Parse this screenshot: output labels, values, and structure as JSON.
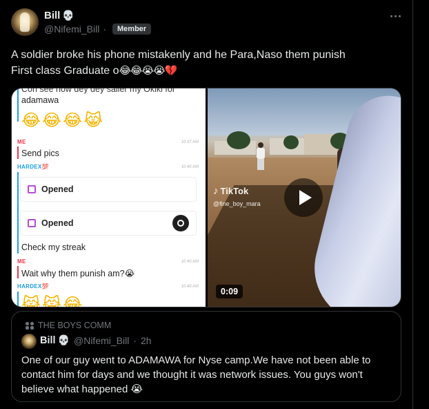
{
  "author": {
    "display_name": "Bill",
    "name_emoji": "💀",
    "handle": "@Nifemi_Bill",
    "separator": "·",
    "badge": "Member"
  },
  "post": {
    "text_line1": "A soldier broke his phone mistakenly and he Para,Naso them punish",
    "text_line2": "First class Graduate o",
    "text_emojis": "😂😂😭😭💔"
  },
  "media": {
    "chat": {
      "partial_top_line": "Con see how dey dey saller my Okiki for",
      "line_adamawa": "adamawa",
      "emoji_row_1": "😂😂😂😹",
      "sender_me": "ME",
      "sender_hardex": "HARDEX💯",
      "msg_send_pics": "Send pics",
      "ts_1": "10:37 AM",
      "ts_2": "10:40 AM",
      "snap_1": "Opened",
      "snap_2": "Opened",
      "msg_check_streak": "Check my streak",
      "ts_3": "10:40 AM",
      "msg_wait_why": "Wait why them punish am?😭",
      "ts_4": "10:40 AM",
      "emoji_row_2": "😹😹😂"
    },
    "video": {
      "watermark": "TikTok",
      "watermark_handle": "@fine_boy_mara",
      "duration": "0:09"
    }
  },
  "quoted": {
    "community": "THE BOYS COMM",
    "display_name": "Bill",
    "name_emoji": "💀",
    "handle": "@Nifemi_Bill",
    "separator": "·",
    "time": "2h",
    "text": "One of our guy went to ADAMAWA for Nyse camp.We have not been able to contact him for days and we thought it was network issues. You guys won't believe what happened",
    "text_emoji": "😭"
  },
  "colors": {
    "background": "#000000",
    "text_primary": "#e7e9ea",
    "text_secondary": "#71767b",
    "border": "#2f3336",
    "snap_me": "#e8374f",
    "snap_friend": "#1c9fe4"
  }
}
